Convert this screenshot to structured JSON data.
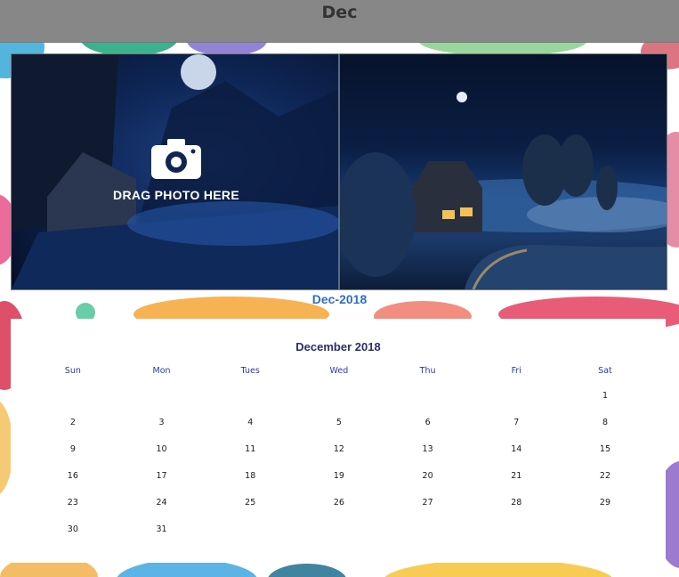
{
  "header": {
    "title": "Dec"
  },
  "photo": {
    "drag_label": "DRAG PHOTO HERE"
  },
  "month_label": "Dec-2018",
  "calendar": {
    "title": "December 2018",
    "weekdays": [
      "Sun",
      "Mon",
      "Tues",
      "Wed",
      "Thu",
      "Fri",
      "Sat"
    ],
    "weeks": [
      [
        "",
        "",
        "",
        "",
        "",
        "",
        "1"
      ],
      [
        "2",
        "3",
        "4",
        "5",
        "6",
        "7",
        "8"
      ],
      [
        "9",
        "10",
        "11",
        "12",
        "13",
        "14",
        "15"
      ],
      [
        "16",
        "17",
        "18",
        "19",
        "20",
        "21",
        "22"
      ],
      [
        "23",
        "24",
        "25",
        "26",
        "27",
        "28",
        "29"
      ],
      [
        "30",
        "31",
        "",
        "",
        "",
        "",
        ""
      ]
    ]
  },
  "colors": {
    "topbar": "#878787",
    "month_label": "#2f6fc2",
    "calendar_title": "#2b2e6a",
    "weekday": "#2f3aa0"
  },
  "icons": {
    "drag_photo": "camera-icon"
  }
}
